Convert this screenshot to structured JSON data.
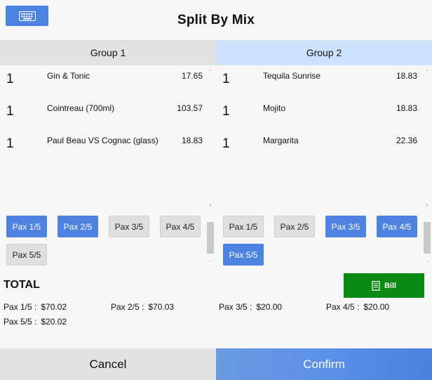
{
  "header": {
    "title": "Split By Mix",
    "keyboard_icon": "keyboard-icon"
  },
  "tabs": [
    {
      "label": "Group 1"
    },
    {
      "label": "Group 2"
    }
  ],
  "group1": {
    "items": [
      {
        "qty": "1",
        "name": "Gin & Tonic",
        "price": "17.65"
      },
      {
        "qty": "1",
        "name": "Cointreau (700ml)",
        "price": "103.57"
      },
      {
        "qty": "1",
        "name": "Paul Beau VS Cognac (glass)",
        "price": "18.83"
      }
    ],
    "pax": [
      {
        "label": "Pax 1/5",
        "selected": true
      },
      {
        "label": "Pax 2/5",
        "selected": true
      },
      {
        "label": "Pax 3/5",
        "selected": false
      },
      {
        "label": "Pax 4/5",
        "selected": false
      },
      {
        "label": "Pax 5/5",
        "selected": false
      }
    ]
  },
  "group2": {
    "items": [
      {
        "qty": "1",
        "name": "Tequila Sunrise",
        "price": "18.83"
      },
      {
        "qty": "1",
        "name": "Mojito",
        "price": "18.83"
      },
      {
        "qty": "1",
        "name": "Margarita",
        "price": "22.36"
      }
    ],
    "pax": [
      {
        "label": "Pax 1/5",
        "selected": false
      },
      {
        "label": "Pax 2/5",
        "selected": false
      },
      {
        "label": "Pax 3/5",
        "selected": true
      },
      {
        "label": "Pax 4/5",
        "selected": true
      },
      {
        "label": "Pax 5/5",
        "selected": true
      }
    ]
  },
  "totals": {
    "label": "TOTAL",
    "bill_label": "Bill",
    "entries": [
      {
        "label": "Pax 1/5 :",
        "amount": "$70.02"
      },
      {
        "label": "Pax 2/5 :",
        "amount": "$70.03"
      },
      {
        "label": "Pax 3/5 :",
        "amount": "$20.00"
      },
      {
        "label": "Pax 4/5 :",
        "amount": "$20.00"
      },
      {
        "label": "Pax 5/5 :",
        "amount": "$20.02"
      }
    ]
  },
  "footer": {
    "cancel_label": "Cancel",
    "confirm_label": "Confirm"
  },
  "colors": {
    "accent_blue": "#4d82e0",
    "group2_tab": "#cce1fb",
    "bill_green": "#0b8a13",
    "neutral_button": "#e2e2e2"
  }
}
